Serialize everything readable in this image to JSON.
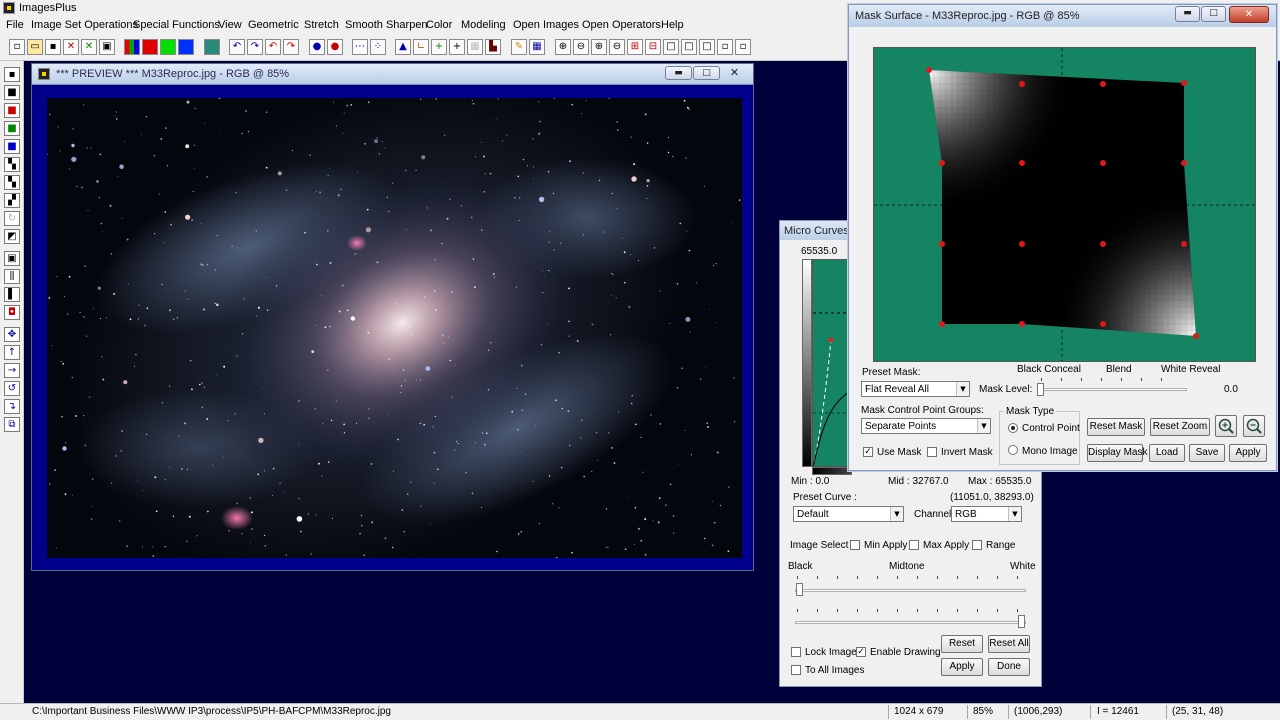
{
  "app": {
    "title": "ImagesPlus"
  },
  "menu": [
    "File",
    "Image Set Operations",
    "Special Functions",
    "View",
    "Geometric",
    "Stretch",
    "Smooth Sharpen",
    "Color",
    "Modeling",
    "Open Images",
    "Open Operators",
    "Help"
  ],
  "preview": {
    "title": "*** PREVIEW *** M33Reproc.jpg - RGB @ 85%",
    "buttons": {
      "minimize": "▬",
      "maximize": "□",
      "close": "✕"
    }
  },
  "micro_curves": {
    "title": "Micro Curves -",
    "max_top_label": "65535.0",
    "min_label": "Min : 0.0",
    "mid_label": "Mid : 32767.0",
    "max_label": "Max : 65535.0",
    "preset_curve_label": "Preset Curve :",
    "coords": "(11051.0, 38293.0)",
    "preset_curve_value": "Default",
    "channel_label": "Channel:",
    "channel_value": "RGB",
    "image_select_label": "Image Select",
    "min_apply": "Min Apply",
    "max_apply": "Max Apply",
    "range": "Range",
    "black": "Black",
    "midtone": "Midtone",
    "white": "White",
    "lock_image": "Lock Image",
    "enable_drawing": "Enable Drawing",
    "to_all_images": "To All Images",
    "reset": "Reset",
    "reset_all": "Reset All",
    "apply": "Apply",
    "done": "Done"
  },
  "mask_surface": {
    "title": "Mask Surface - M33Reproc.jpg - RGB @ 85%",
    "preset_mask_label": "Preset Mask:",
    "preset_mask_value": "Flat Reveal All",
    "black_conceal": "Black Conceal",
    "blend": "Blend",
    "white_reveal": "White Reveal",
    "mask_level_label": "Mask Level:",
    "mask_level_value": "0.0",
    "control_groups_label": "Mask Control Point Groups:",
    "control_groups_value": "Separate Points",
    "mask_type_label": "Mask Type",
    "control_point": "Control Point",
    "mono_image": "Mono Image",
    "use_mask": "Use Mask",
    "invert_mask": "Invert Mask",
    "reset_mask": "Reset Mask",
    "reset_zoom": "Reset Zoom",
    "display_mask": "Display Mask",
    "load": "Load",
    "save": "Save",
    "apply": "Apply"
  },
  "status": {
    "path": "C:\\Important Business Files\\WWW IP3\\process\\IP5\\PH-BAFCPM\\M33Reproc.jpg",
    "dimensions": "1024 x 679",
    "zoom": "85%",
    "cursor": "(1006,293)",
    "intensity": "I = 12461",
    "rgb": "(25, 31, 48)"
  }
}
